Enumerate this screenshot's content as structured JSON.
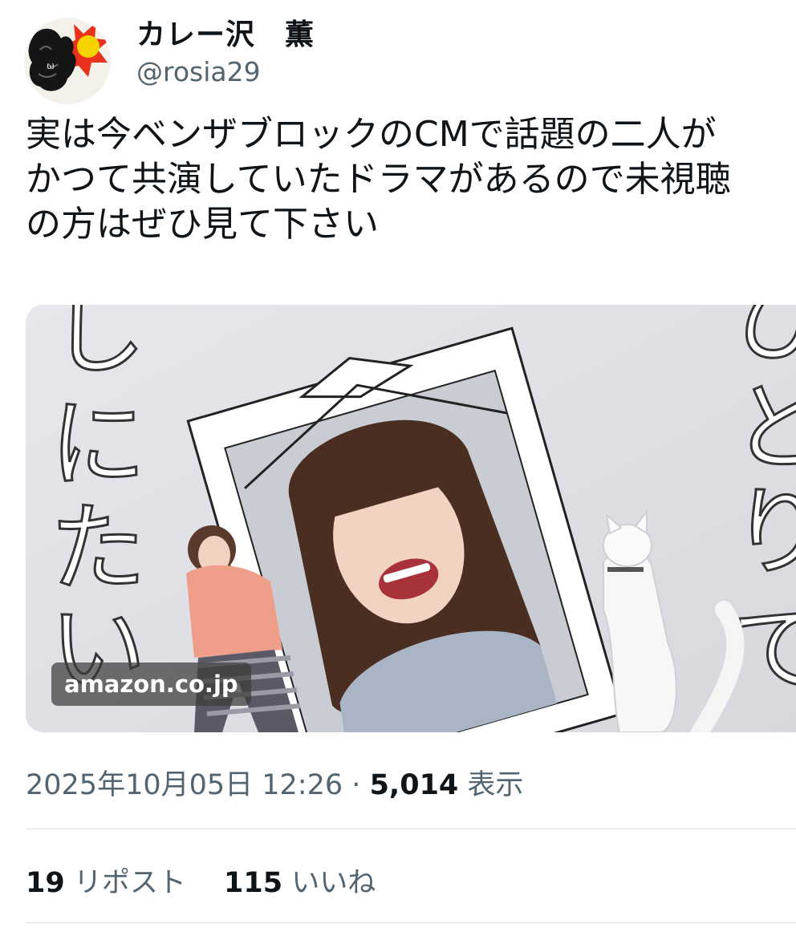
{
  "author": {
    "display_name": "カレー沢　薫",
    "handle": "@rosia29"
  },
  "tweet": {
    "lines": [
      "実は今ベンザブロックのCMで話題の二人が",
      "かつて共演していたドラマがあるので未視聴",
      "の方はぜひ見て下さい"
    ]
  },
  "media": {
    "source_label": "amazon.co.jp",
    "poster_text_left": [
      "し",
      "に",
      "た",
      "い"
    ],
    "poster_text_right": [
      "ひ",
      "と",
      "り",
      "で"
    ]
  },
  "meta": {
    "timestamp": "2025年10月05日 12:26",
    "separator": "·",
    "views_count": "5,014",
    "views_label": "表示"
  },
  "stats": {
    "reposts_count": "19",
    "reposts_label": "リポスト",
    "likes_count": "115",
    "likes_label": "いいね"
  },
  "colors": {
    "secondary_text": "#536471",
    "primary_text": "#0f1419",
    "divider": "#dfe3e7"
  }
}
